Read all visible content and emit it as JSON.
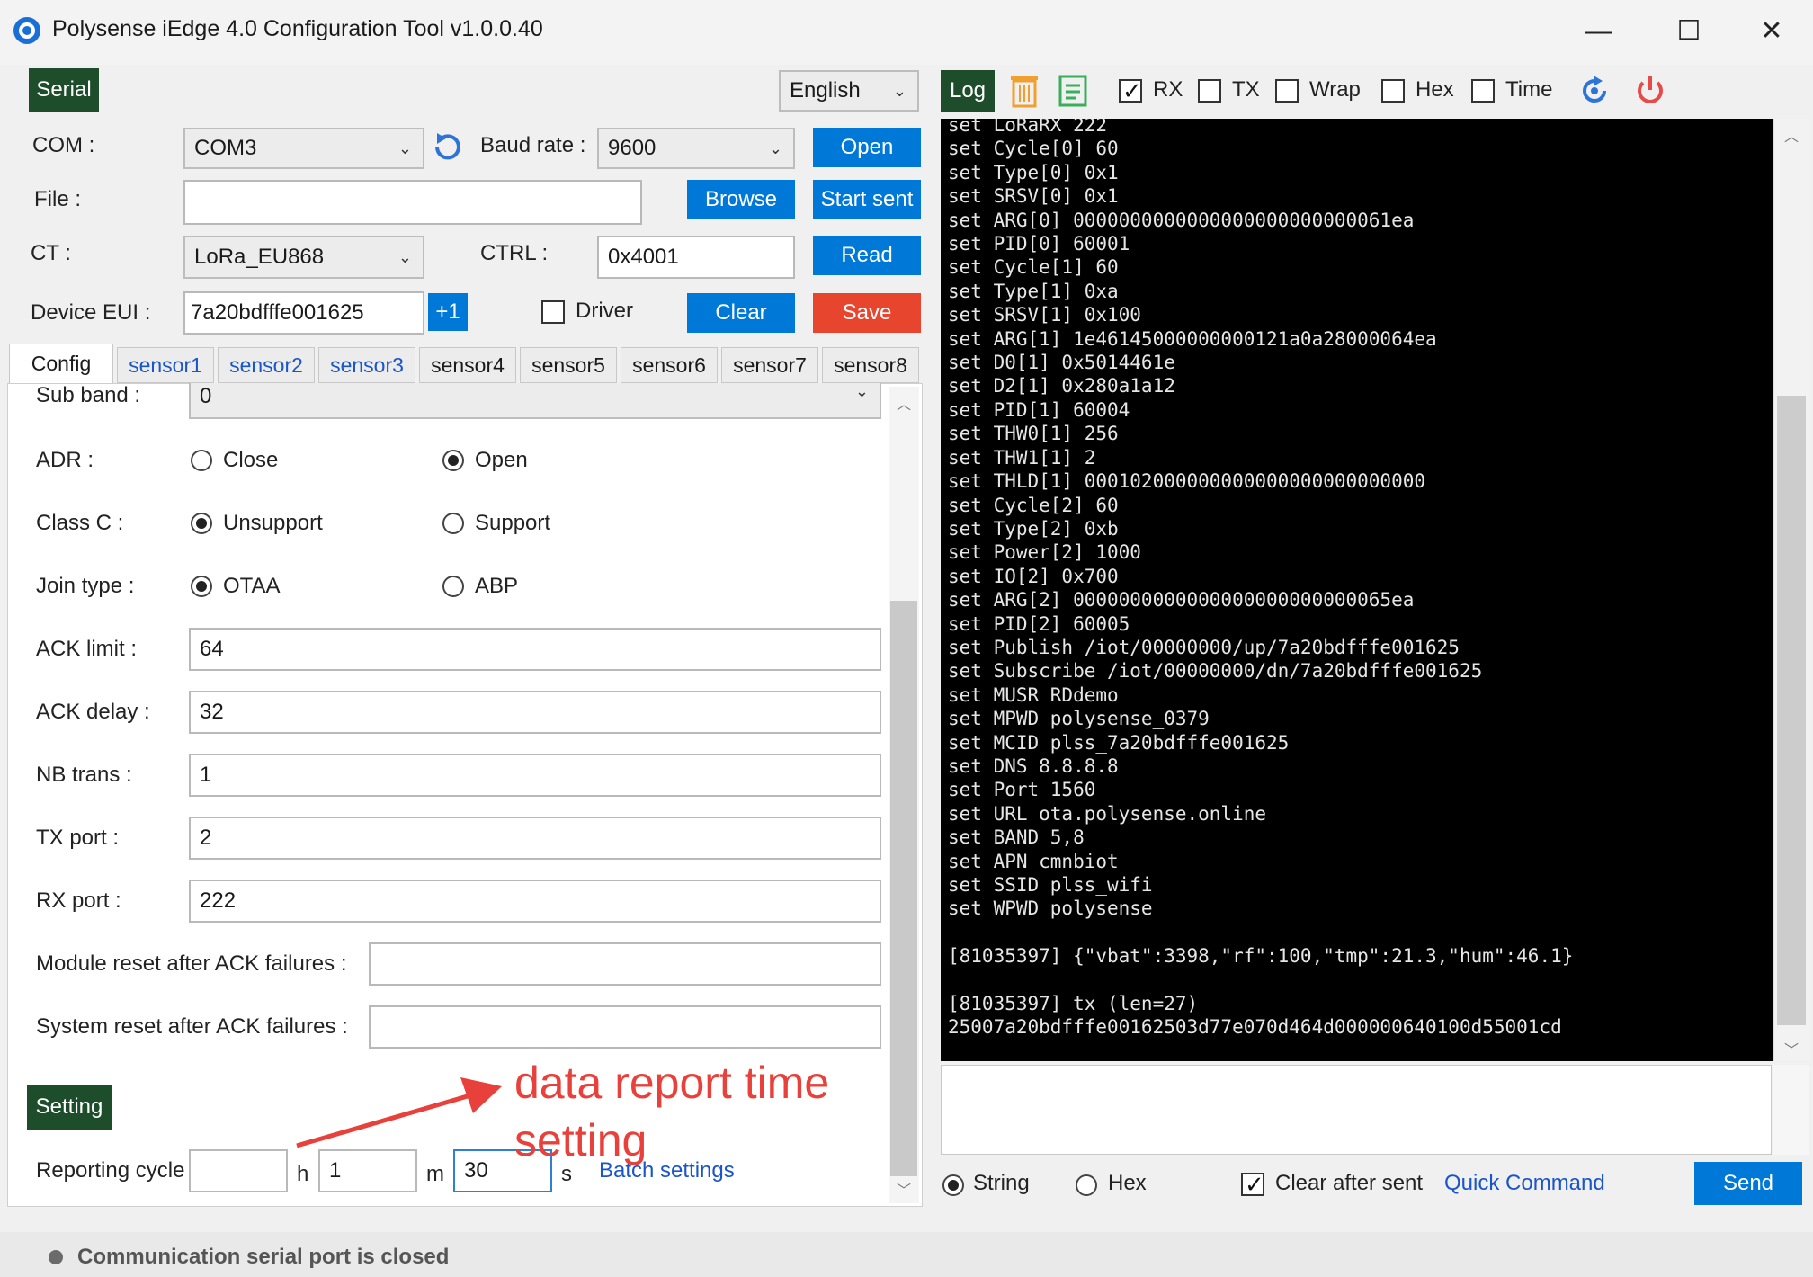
{
  "app": {
    "title": "Polysense iEdge 4.0 Configuration Tool v1.0.0.40",
    "minimize_icon": "minimize-icon",
    "maximize_icon": "maximize-icon",
    "close_icon": "close-icon"
  },
  "serial": {
    "section_label": "Serial",
    "language": "English",
    "com_label": "COM :",
    "com_value": "COM3",
    "baud_label": "Baud rate :",
    "baud_value": "9600",
    "open_label": "Open",
    "file_label": "File :",
    "file_value": "",
    "browse_label": "Browse",
    "start_sent_label": "Start sent",
    "ct_label": "CT :",
    "ct_value": "LoRa_EU868",
    "ctrl_label": "CTRL :",
    "ctrl_value": "0x4001",
    "read_label": "Read",
    "eui_label": "Device EUI :",
    "eui_value": "7a20bdfffe001625",
    "plus_one_label": "+1",
    "driver_label": "Driver",
    "clear_label": "Clear",
    "save_label": "Save"
  },
  "tabs": [
    "Config",
    "sensor1",
    "sensor2",
    "sensor3",
    "sensor4",
    "sensor5",
    "sensor6",
    "sensor7",
    "sensor8"
  ],
  "config": {
    "subband_label": "Sub band :",
    "subband_value": "0",
    "adr_label": "ADR :",
    "adr_close": "Close",
    "adr_open": "Open",
    "classc_label": "Class C :",
    "classc_unsupport": "Unsupport",
    "classc_support": "Support",
    "join_label": "Join type :",
    "join_otaa": "OTAA",
    "join_abp": "ABP",
    "ack_limit_label": "ACK limit :",
    "ack_limit_value": "64",
    "ack_delay_label": "ACK delay :",
    "ack_delay_value": "32",
    "nb_trans_label": "NB trans :",
    "nb_trans_value": "1",
    "tx_port_label": "TX port :",
    "tx_port_value": "2",
    "rx_port_label": "RX port :",
    "rx_port_value": "222",
    "module_reset_label": "Module reset after ACK failures :",
    "module_reset_value": "",
    "system_reset_label": "System reset after ACK failures :",
    "system_reset_value": "",
    "setting_label": "Setting",
    "reporting_label": "Reporting cycle",
    "hours_value": "",
    "h_unit": "h",
    "minutes_value": "1",
    "m_unit": "m",
    "seconds_value": "30",
    "s_unit": "s",
    "batch_label": "Batch settings",
    "annotation_text": "data report time setting",
    "annotation_color": "#e8413b"
  },
  "log": {
    "section_label": "Log",
    "rx_label": "RX",
    "tx_label": "TX",
    "wrap_label": "Wrap",
    "hex_label": "Hex",
    "time_label": "Time",
    "lines": [
      "set LoRaRX 222",
      "set Cycle[0] 60",
      "set Type[0] 0x1",
      "set SRSV[0] 0x1",
      "set ARG[0] 0000000000000000000000000061ea",
      "set PID[0] 60001",
      "set Cycle[1] 60",
      "set Type[1] 0xa",
      "set SRSV[1] 0x100",
      "set ARG[1] 1e46145000000000121a0a28000064ea",
      "set D0[1] 0x5014461e",
      "set D2[1] 0x280a1a12",
      "set PID[1] 60004",
      "set THW0[1] 256",
      "set THW1[1] 2",
      "set THLD[1] 000102000000000000000000000000",
      "set Cycle[2] 60",
      "set Type[2] 0xb",
      "set Power[2] 1000",
      "set IO[2] 0x700",
      "set ARG[2] 0000000000000000000000000065ea",
      "set PID[2] 60005",
      "set Publish /iot/00000000/up/7a20bdfffe001625",
      "set Subscribe /iot/00000000/dn/7a20bdfffe001625",
      "set MUSR RDdemo",
      "set MPWD polysense_0379",
      "set MCID plss_7a20bdfffe001625",
      "set DNS 8.8.8.8",
      "set Port 1560",
      "set URL ota.polysense.online",
      "set BAND 5,8",
      "set APN cmnbiot",
      "set SSID plss_wifi",
      "set WPWD polysense",
      "",
      "[81035397] {\"vbat\":3398,\"rf\":100,\"tmp\":21.3,\"hum\":46.1}",
      "",
      "[81035397] tx (len=27)",
      "25007a20bdfffe00162503d77e070d464d000000640100d55001cd"
    ],
    "send_input_value": "",
    "string_label": "String",
    "hex_mode_label": "Hex",
    "clear_after_sent_label": "Clear after sent",
    "quick_command_label": "Quick Command",
    "send_label": "Send"
  },
  "status": {
    "text": "Communication serial port is closed"
  }
}
